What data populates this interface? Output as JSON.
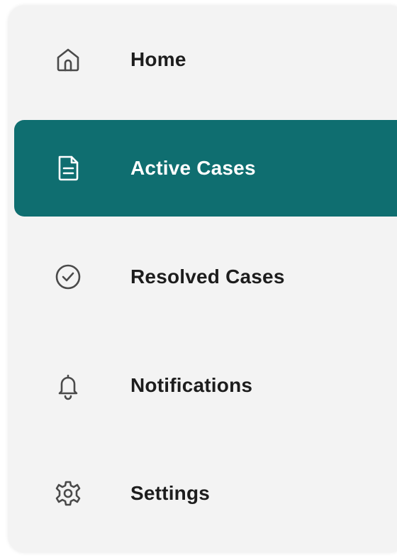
{
  "theme": {
    "accent": "#0f6e70",
    "panel_bg": "#f3f3f3",
    "text": "#1d1d1d"
  },
  "nav": {
    "items": [
      {
        "id": "home",
        "label": "Home",
        "icon": "home-icon",
        "active": false
      },
      {
        "id": "active-cases",
        "label": "Active Cases",
        "icon": "document-icon",
        "active": true
      },
      {
        "id": "resolved-cases",
        "label": "Resolved Cases",
        "icon": "check-circle-icon",
        "active": false
      },
      {
        "id": "notifications",
        "label": "Notifications",
        "icon": "bell-icon",
        "active": false
      },
      {
        "id": "settings",
        "label": "Settings",
        "icon": "gear-icon",
        "active": false
      }
    ]
  }
}
